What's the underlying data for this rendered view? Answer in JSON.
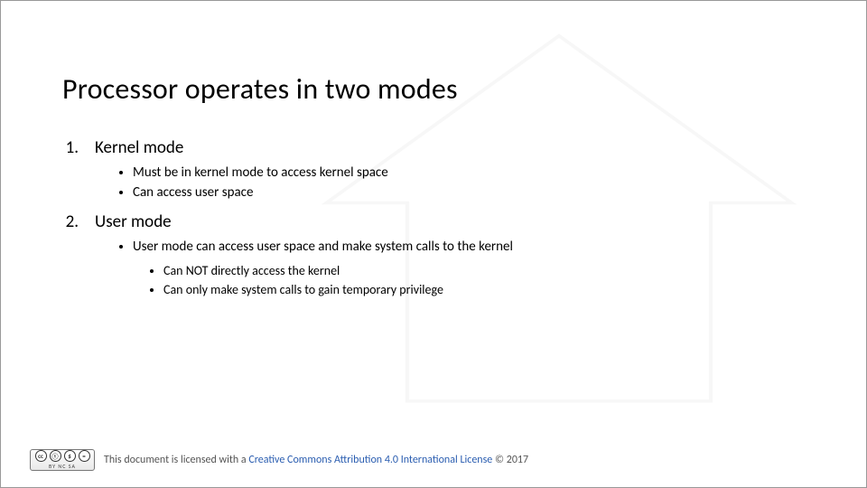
{
  "title": "Processor operates in two modes",
  "items": [
    {
      "num": "1.",
      "label": "Kernel mode",
      "bullets": [
        "Must be in kernel mode to access kernel space",
        "Can access user space"
      ],
      "sub": []
    },
    {
      "num": "2.",
      "label": "User mode",
      "bullets": [
        "User mode can access user space and make system calls to the kernel"
      ],
      "sub": [
        "Can NOT directly access the kernel",
        "Can only make system  calls to gain temporary privilege"
      ]
    }
  ],
  "footer": {
    "prefix": "This document is licensed with a ",
    "link_text": "Creative Commons Attribution 4.0 International License",
    "year": "2017"
  },
  "cc": {
    "c1": "cc",
    "c2": "①",
    "c3": "$",
    "c4": "=",
    "bar": "BY   NC   SA"
  }
}
